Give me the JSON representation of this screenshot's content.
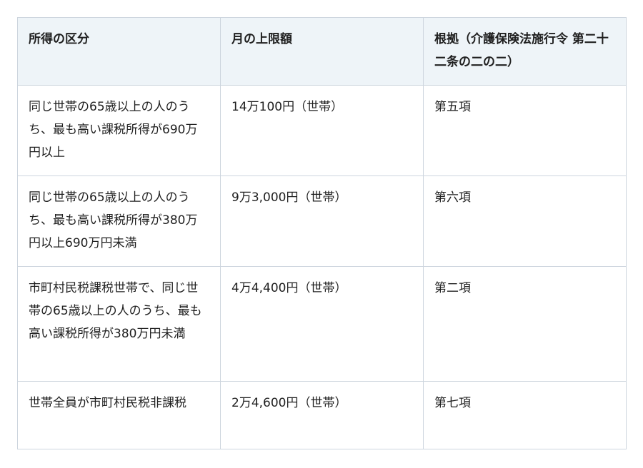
{
  "table": {
    "headers": [
      "所得の区分",
      "月の上限額",
      "根拠（介護保険法施行令 第二十二条の二の二）"
    ],
    "rows": [
      {
        "category": "同じ世帯の65歳以上の人のうち、最も高い課税所得が690万円以上",
        "limit": "14万100円（世帯）",
        "basis": "第五項"
      },
      {
        "category": "同じ世帯の65歳以上の人のうち、最も高い課税所得が380万円以上690万円未満",
        "limit": "9万3,000円（世帯）",
        "basis": "第六項"
      },
      {
        "category": "市町村民税課税世帯で、同じ世帯の65歳以上の人のうち、最も高い課税所得が380万円未満",
        "limit": "4万4,400円（世帯）",
        "basis": "第二項"
      },
      {
        "category": "世帯全員が市町村民税非課税",
        "limit": "2万4,600円（世帯）",
        "basis": "第七項"
      }
    ]
  },
  "colors": {
    "header_bg": "#eef4f8",
    "border": "#cdd5de",
    "text": "#1f1f1f"
  }
}
